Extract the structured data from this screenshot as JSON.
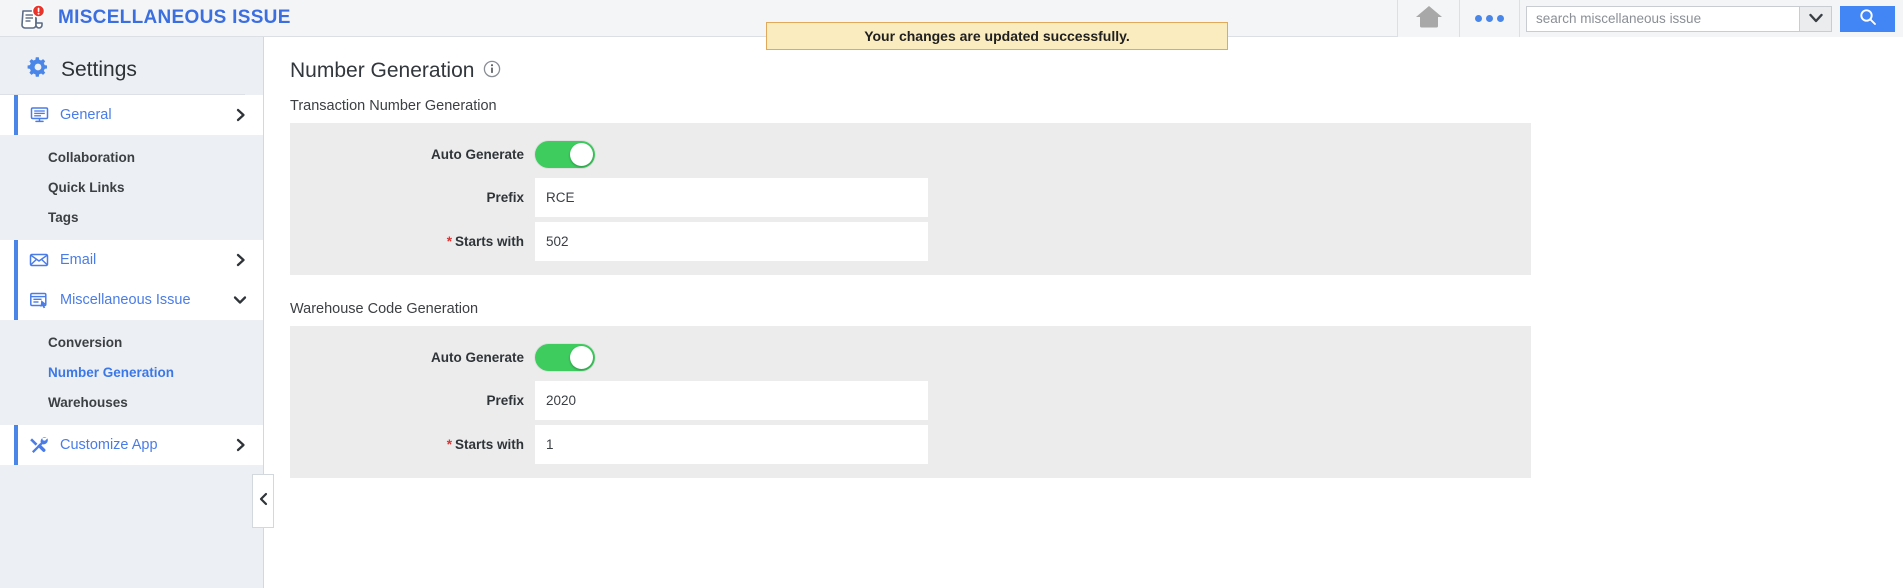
{
  "header": {
    "app_title": "MISCELLANEOUS ISSUE",
    "logo_icon": "document-alert-icon",
    "badge_icon": "alert-badge-icon",
    "home_icon": "home-icon",
    "more_icon": "more-options-icon",
    "search": {
      "placeholder": "search miscellaneous issue",
      "value": "",
      "caret_icon": "chevron-down-icon",
      "button_icon": "search-icon"
    },
    "toast": {
      "message": "Your changes are updated successfully.",
      "background": "#faecbf",
      "border": "#e2a95a"
    }
  },
  "sidebar": {
    "title": "Settings",
    "gear_icon": "gear-icon",
    "collapse_icon": "chevron-left-icon",
    "groups": [
      {
        "label": "General",
        "icon": "monitor-icon",
        "active": true,
        "chevron": "chevron-right-icon",
        "children": [
          {
            "label": "Collaboration",
            "current": false
          },
          {
            "label": "Quick Links",
            "current": false
          },
          {
            "label": "Tags",
            "current": false
          }
        ]
      },
      {
        "label": "Email",
        "icon": "envelope-icon",
        "active": true,
        "chevron": "chevron-right-icon",
        "children": []
      },
      {
        "label": "Miscellaneous Issue",
        "icon": "form-cursor-icon",
        "active": true,
        "chevron": "chevron-down-icon",
        "children": [
          {
            "label": "Conversion",
            "current": false
          },
          {
            "label": "Number Generation",
            "current": true
          },
          {
            "label": "Warehouses",
            "current": false
          }
        ]
      },
      {
        "label": "Customize App",
        "icon": "tools-icon",
        "active": true,
        "chevron": "chevron-right-icon",
        "children": []
      }
    ]
  },
  "main": {
    "page_title": "Number Generation",
    "info_icon": "info-icon",
    "sections": [
      {
        "label": "Transaction Number Generation",
        "fields": {
          "auto_generate_label": "Auto Generate",
          "auto_generate_on": true,
          "prefix_label": "Prefix",
          "prefix_value": "RCE",
          "starts_with_label": "Starts with",
          "starts_with_value": "502",
          "required_marker": "*"
        }
      },
      {
        "label": "Warehouse Code Generation",
        "fields": {
          "auto_generate_label": "Auto Generate",
          "auto_generate_on": true,
          "prefix_label": "Prefix",
          "prefix_value": "2020",
          "starts_with_label": "Starts with",
          "starts_with_value": "1",
          "required_marker": "*"
        }
      }
    ]
  },
  "colors": {
    "brand_blue": "#3b6fe0",
    "accent_blue": "#4285f4",
    "toggle_green": "#3ecc5f",
    "required_red": "#e03131",
    "sidebar_bg": "#eceff4",
    "panel_bg": "#ececec"
  }
}
